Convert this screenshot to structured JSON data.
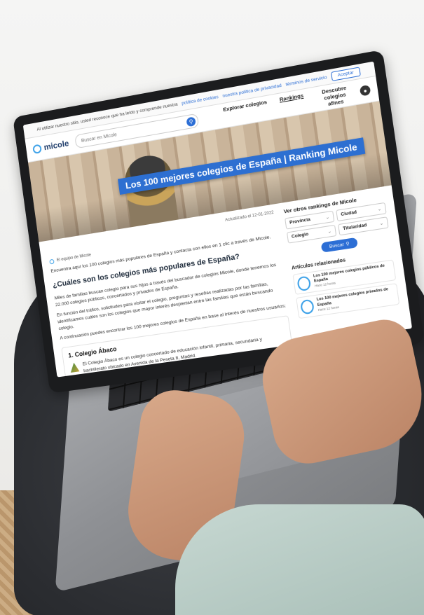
{
  "cookie_bar": {
    "text": "Al utilizar nuestro sitio, usted reconoce que ha leído y comprende nuestra",
    "link_cookies": "política de cookies",
    "link_privacy": "nuestra política de privacidad",
    "link_terms": "términos de servicio",
    "accept_label": "Aceptar"
  },
  "header": {
    "logo": "micole",
    "search_placeholder": "Buscar en Micole",
    "nav": [
      "Explorar colegios",
      "Rankings",
      "Descubre colegios afines"
    ]
  },
  "hero": {
    "title": "Los 100 mejores colegios de España | Ranking Micole"
  },
  "main": {
    "updated": "Actualizado el 12-01-2022",
    "breadcrumb": "El equipo de Micole",
    "intro": "Encuentra aquí los 100 colegios más populares de España y contacta con ellos en 1 clic a través de Micole.",
    "heading": "¿Cuáles son los colegios más populares de España?",
    "para1": "Miles de familias buscan colegio para sus hijos a través del buscador de colegios Micole, donde tenemos los 22.000 colegios públicos, concertados y privados de España.",
    "para2": "En función del tráfico, solicitudes para visitar el colegio, preguntas y reseñas realizadas por las familias, identificamos cuáles son los colegios que mayor interés despiertan entre las familias que están buscando colegio.",
    "para3": "A continuación puedes encontrar los 100 mejores colegios de España en base al interés de nuestros usuarios:",
    "rank_title": "1. Colegio Ábaco",
    "rank_text": "El Colegio Ábaco es un colegio concertado de educación infantil, primaria, secundaria y bachillerato ubicado en Avenida de la Peseta 8, Madrid."
  },
  "sidebar": {
    "title": "Ver otros rankings de Micole",
    "selects": [
      "Provincia",
      "Ciudad",
      "Colegio",
      "Titularidad"
    ],
    "search_button": "Buscar",
    "articles_title": "Artículos relacionados",
    "articles": [
      {
        "title": "Los 100 mejores colegios públicos de España",
        "meta": "Hace 12 horas"
      },
      {
        "title": "Los 100 mejores colegios privados de España",
        "meta": "Hace 12 horas"
      }
    ]
  },
  "colors": {
    "accent": "#2c6ed5",
    "logo": "#3aa0e8"
  }
}
